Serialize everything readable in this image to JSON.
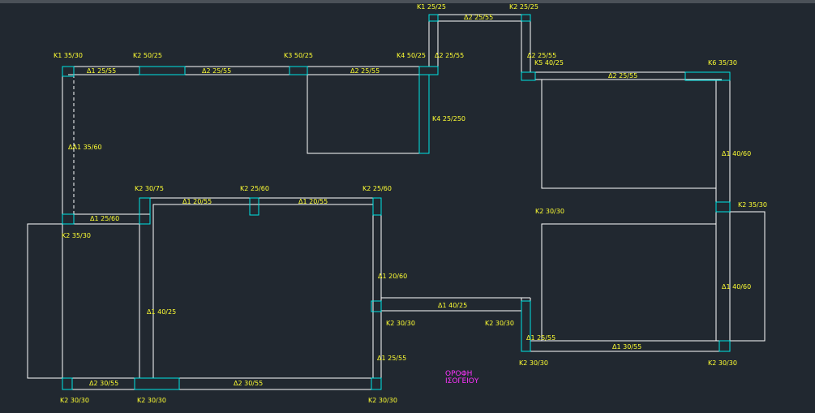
{
  "colors": {
    "background": "#212830",
    "line": "#ffffff",
    "column": "#00e5e5",
    "label": "#ffff33",
    "title": "#ff33ff"
  },
  "title": {
    "line1": "ΟΡΟΦΗ",
    "line2": "ΙΣΟΓΕΙΟΥ"
  },
  "labels": [
    {
      "id": "k1-35-30",
      "text": "K1 35/30"
    },
    {
      "id": "k2-50-25",
      "text": "K2 50/25"
    },
    {
      "id": "k3-50-25",
      "text": "K3 50/25"
    },
    {
      "id": "k4-50-25",
      "text": "K4 50/25"
    },
    {
      "id": "k1-25-25",
      "text": "K1 25/25"
    },
    {
      "id": "k2-25-25-top",
      "text": "K2 25/25"
    },
    {
      "id": "d2-25-55-topbay",
      "text": "Δ2 25/55"
    },
    {
      "id": "d2-25-55-right-of-k4",
      "text": "Δ2 25/55"
    },
    {
      "id": "d2-25-55-above-k5",
      "text": "Δ2 25/55"
    },
    {
      "id": "k5-40-25",
      "text": "K5 40/25"
    },
    {
      "id": "k6-35-30",
      "text": "K6 35/30"
    },
    {
      "id": "d1-25-55-top-left",
      "text": "Δ1 25/55"
    },
    {
      "id": "d2-25-55-top-mid",
      "text": "Δ2 25/55"
    },
    {
      "id": "d2-25-55-top-right",
      "text": "Δ2 25/55"
    },
    {
      "id": "d2-25-55-right-top",
      "text": "Δ2 25/55"
    },
    {
      "id": "k4-25-250",
      "text": "K4 25/250"
    },
    {
      "id": "da1-35-60",
      "text": "ΔΑ1 35/60"
    },
    {
      "id": "d1-40-60-right-top",
      "text": "Δ1 40/60"
    },
    {
      "id": "k2-30-75",
      "text": "K2 30/75"
    },
    {
      "id": "k2-25-60-mid",
      "text": "K2 25/60"
    },
    {
      "id": "k2-25-60-right",
      "text": "K2 25/60"
    },
    {
      "id": "d1-20-55-left",
      "text": "Δ1 20/55"
    },
    {
      "id": "d1-20-55-right",
      "text": "Δ1 20/55"
    },
    {
      "id": "d1-25-60",
      "text": "Δ1 25/60"
    },
    {
      "id": "k2-35-30-left",
      "text": "K2 35/30"
    },
    {
      "id": "k2-30-30-mid-right",
      "text": "K2 30/30"
    },
    {
      "id": "k2-35-30-right",
      "text": "K2 35/30"
    },
    {
      "id": "d1-20-60",
      "text": "Δ1 20/60"
    },
    {
      "id": "d1-40-25-left",
      "text": "Δ1 40/25"
    },
    {
      "id": "d1-40-25-bridge",
      "text": "Δ1 40/25"
    },
    {
      "id": "k2-30-30-bridge-left",
      "text": "K2 30/30"
    },
    {
      "id": "k2-30-30-bridge-right",
      "text": "K2 30/30"
    },
    {
      "id": "d1-40-60-right-bottom",
      "text": "Δ1 40/60"
    },
    {
      "id": "d1-25-55-right-bottom",
      "text": "Δ1 25/55"
    },
    {
      "id": "d1-25-55-left-bottom",
      "text": "Δ1 25/55"
    },
    {
      "id": "d1-30-55",
      "text": "Δ1 30/55"
    },
    {
      "id": "k2-30-30-bottom-mid",
      "text": "K2 30/30"
    },
    {
      "id": "k2-30-30-bottom-right",
      "text": "K2 30/30"
    },
    {
      "id": "d2-30-55-left",
      "text": "Δ2 30/55"
    },
    {
      "id": "d2-30-55-mid",
      "text": "Δ2 30/55"
    },
    {
      "id": "k2-30-30-bl1",
      "text": "K2 30/30"
    },
    {
      "id": "k2-30-30-bl2",
      "text": "K2 30/30"
    },
    {
      "id": "k2-30-30-bl3",
      "text": "K2 30/30"
    }
  ]
}
